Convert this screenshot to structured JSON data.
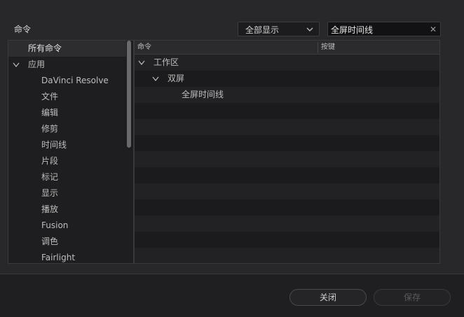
{
  "panel": {
    "title": "命令",
    "filter_dropdown": {
      "selected": "全部显示"
    },
    "search": {
      "value": "全屏时间线"
    }
  },
  "tree": {
    "items": [
      {
        "label": "所有命令",
        "depth": 0,
        "selected": true,
        "expanded": null
      },
      {
        "label": "应用",
        "depth": 0,
        "selected": false,
        "expanded": true
      },
      {
        "label": "DaVinci Resolve",
        "depth": 1
      },
      {
        "label": "文件",
        "depth": 1
      },
      {
        "label": "编辑",
        "depth": 1
      },
      {
        "label": "修剪",
        "depth": 1
      },
      {
        "label": "时间线",
        "depth": 1
      },
      {
        "label": "片段",
        "depth": 1
      },
      {
        "label": "标记",
        "depth": 1
      },
      {
        "label": "显示",
        "depth": 1
      },
      {
        "label": "播放",
        "depth": 1
      },
      {
        "label": "Fusion",
        "depth": 1
      },
      {
        "label": "调色",
        "depth": 1
      },
      {
        "label": "Fairlight",
        "depth": 1
      }
    ]
  },
  "table": {
    "headers": {
      "command": "命令",
      "shortcut": "按键"
    },
    "rows": [
      {
        "label": "工作区",
        "depth": 0,
        "expanded": true
      },
      {
        "label": "双屏",
        "depth": 1,
        "expanded": true
      },
      {
        "label": "全屏时间线",
        "depth": 2,
        "expanded": null
      },
      {
        "label": ""
      },
      {
        "label": ""
      },
      {
        "label": ""
      },
      {
        "label": ""
      },
      {
        "label": ""
      },
      {
        "label": ""
      },
      {
        "label": ""
      },
      {
        "label": ""
      },
      {
        "label": ""
      },
      {
        "label": ""
      }
    ]
  },
  "footer": {
    "close_label": "关闭",
    "save_label": "保存"
  }
}
